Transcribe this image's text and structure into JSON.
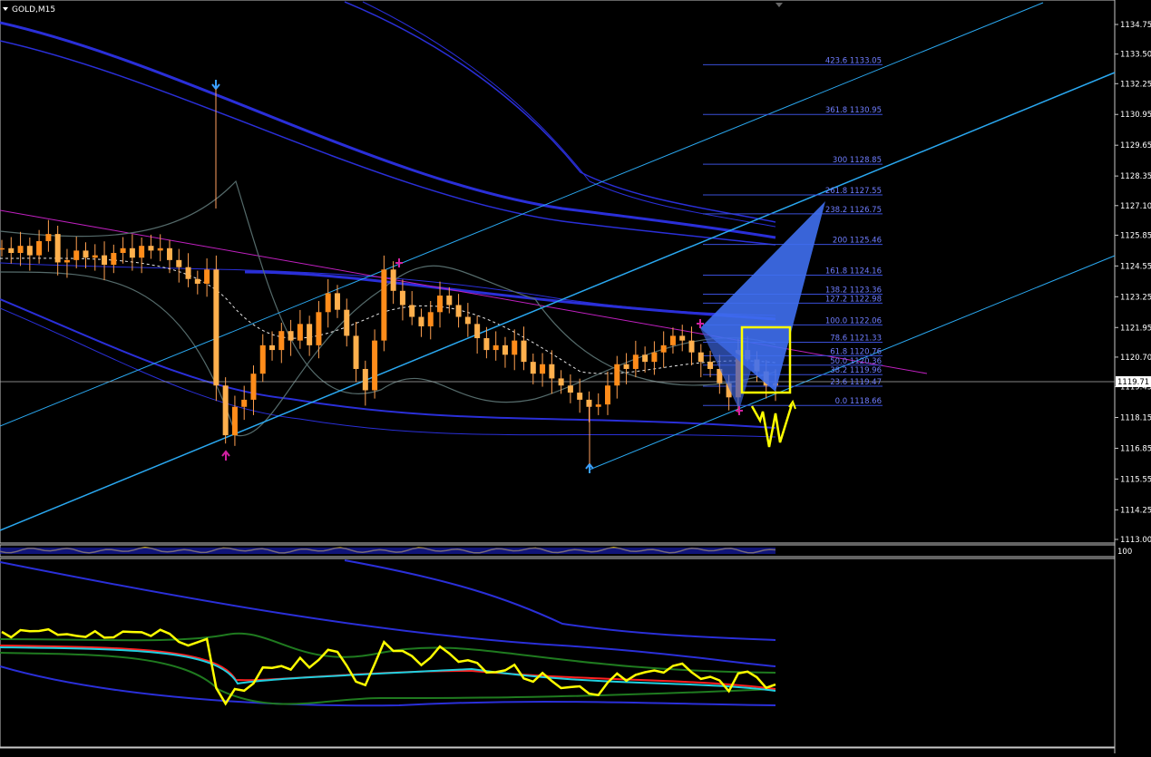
{
  "symbol_label": "GOLD,M15",
  "price_marker": "1119.71",
  "sub_window_label": "100",
  "chart_data": {
    "type": "line",
    "title": "GOLD,M15",
    "xlabel": "",
    "ylabel": "",
    "ylim": [
      1113.0,
      1135.5
    ],
    "grid": false,
    "legend": "none",
    "y_ticks": [
      "1134.75",
      "1133.50",
      "1132.25",
      "1130.95",
      "1129.65",
      "1128.35",
      "1127.10",
      "1125.85",
      "1124.55",
      "1123.25",
      "1121.95",
      "1120.70",
      "1119.45",
      "1118.15",
      "1116.85",
      "1115.55",
      "1114.25",
      "1113.00"
    ],
    "current_price": 1119.71,
    "fibonacci_levels": [
      {
        "label": "423.6 1133.05",
        "ratio": 423.6,
        "price": 1133.05
      },
      {
        "label": "361.8 1130.95",
        "ratio": 361.8,
        "price": 1130.95
      },
      {
        "label": "300 1128.85",
        "ratio": 300,
        "price": 1128.85
      },
      {
        "label": "261.8 1127.55",
        "ratio": 261.8,
        "price": 1127.55
      },
      {
        "label": "238.2 1126.75",
        "ratio": 238.2,
        "price": 1126.75
      },
      {
        "label": "200 1125.46",
        "ratio": 200,
        "price": 1125.46
      },
      {
        "label": "161.8 1124.16",
        "ratio": 161.8,
        "price": 1124.16
      },
      {
        "label": "138.2 1123.36",
        "ratio": 138.2,
        "price": 1123.36
      },
      {
        "label": "127.2 1122.98",
        "ratio": 127.2,
        "price": 1122.98
      },
      {
        "label": "100.0 1122.06",
        "ratio": 100.0,
        "price": 1122.06
      },
      {
        "label": "78.6 1121.33",
        "ratio": 78.6,
        "price": 1121.33
      },
      {
        "label": "61.8 1120.76",
        "ratio": 61.8,
        "price": 1120.76
      },
      {
        "label": "50.0 1120.36",
        "ratio": 50.0,
        "price": 1120.36
      },
      {
        "label": "38.2 1119.96",
        "ratio": 38.2,
        "price": 1119.96
      },
      {
        "label": "23.6 1119.47",
        "ratio": 23.6,
        "price": 1119.47
      },
      {
        "label": "0.0 1118.66",
        "ratio": 0.0,
        "price": 1118.66
      }
    ],
    "close_series": [
      1125.3,
      1125.1,
      1125.4,
      1125.0,
      1125.6,
      1125.9,
      1124.7,
      1124.8,
      1125.2,
      1124.9,
      1125.0,
      1124.6,
      1125.1,
      1125.3,
      1124.9,
      1125.4,
      1125.2,
      1125.3,
      1124.8,
      1124.5,
      1124.0,
      1123.8,
      1124.4,
      1119.5,
      1117.4,
      1118.6,
      1118.9,
      1120.0,
      1121.2,
      1121.0,
      1121.8,
      1121.4,
      1122.1,
      1121.2,
      1122.6,
      1123.4,
      1122.7,
      1121.6,
      1120.2,
      1119.3,
      1121.4,
      1124.4,
      1123.5,
      1122.9,
      1122.4,
      1122.0,
      1122.6,
      1123.3,
      1122.9,
      1122.4,
      1122.1,
      1121.5,
      1121.0,
      1121.2,
      1120.8,
      1121.4,
      1120.5,
      1120.0,
      1120.4,
      1119.8,
      1119.5,
      1119.2,
      1118.9,
      1118.6,
      1118.7,
      1119.5,
      1120.4,
      1120.2,
      1120.8,
      1120.5,
      1120.9,
      1121.2,
      1121.6,
      1121.4,
      1120.9,
      1120.5,
      1120.2,
      1119.6,
      1119.0,
      1121.0,
      1120.6,
      1120.1,
      1119.5,
      1119.6
    ]
  }
}
